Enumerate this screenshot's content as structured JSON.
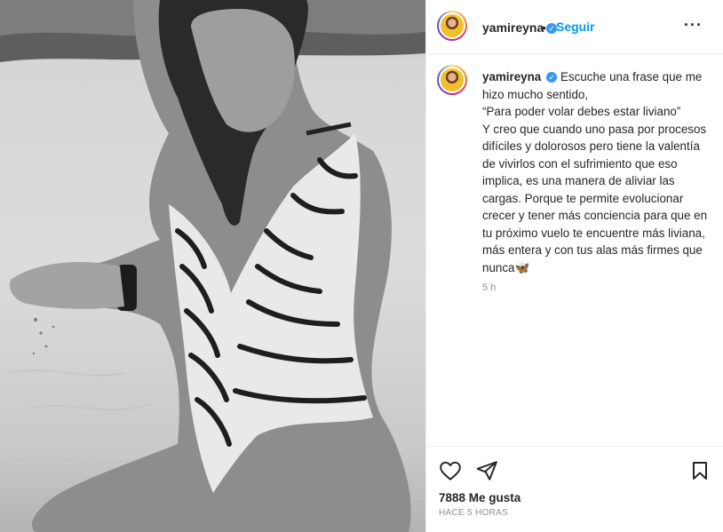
{
  "post": {
    "author": {
      "username": "yamireyna",
      "verified_icon": "verified-badge-icon",
      "separator": "•",
      "follow_label": "Seguir",
      "more_icon": "more-options-icon",
      "more_label": "···"
    },
    "caption": {
      "username": "yamireyna",
      "lines": [
        "Escuche una frase que me hizo mucho sentido,",
        "“Para poder volar debes estar liviano”",
        "Y creo que cuando uno pasa por procesos difíciles y dolorosos pero tiene la valentía de vivirlos con el sufrimiento que eso implica, es una manera de aliviar las cargas. Porque te permite evolucionar crecer y tener más conciencia para que en tu próximo vuelo te encuentre más liviana, más entera y con tus alas más firmes que nunca"
      ],
      "emoji": "🦋",
      "time": "5 h"
    },
    "actions": {
      "like_icon": "heart-icon",
      "share_icon": "paper-plane-icon",
      "save_icon": "bookmark-icon",
      "likes_text": "7888 Me gusta",
      "posted_ago": "HACE 5 HORAS"
    },
    "photo": {
      "description_icon": "post-photo",
      "colors": {
        "sky": "#bdbdbd",
        "water": "#d8d8d8",
        "skin": "#8f8f8f",
        "hair": "#2a2a2a"
      }
    }
  }
}
